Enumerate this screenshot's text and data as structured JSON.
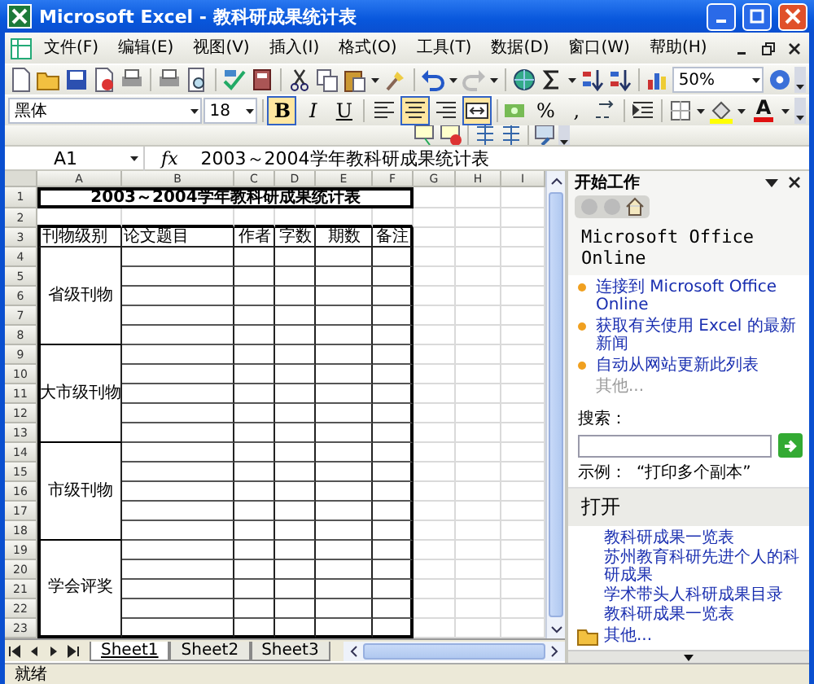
{
  "window": {
    "title": "Microsoft Excel - 教科研成果统计表"
  },
  "menu": [
    "文件(F)",
    "编辑(E)",
    "视图(V)",
    "插入(I)",
    "格式(O)",
    "工具(T)",
    "数据(D)",
    "窗口(W)",
    "帮助(H)"
  ],
  "standard_toolbar": {
    "zoom": "50%"
  },
  "format_toolbar": {
    "font": "黑体",
    "size": "18",
    "style_buttons": [
      {
        "label": "B",
        "selected": true
      },
      {
        "label": "I",
        "selected": false
      },
      {
        "label": "U",
        "selected": false
      }
    ],
    "align_buttons": [
      {
        "selected": false
      },
      {
        "selected": true
      },
      {
        "selected": false
      },
      {
        "selected": true
      }
    ],
    "percent": "%",
    "comma": ",",
    "font_color": "A"
  },
  "formula_bar": {
    "cell": "A1",
    "function_label": "fx",
    "value": "2003～2004学年教科研成果统计表"
  },
  "sheet": {
    "columns": [
      "A",
      "B",
      "C",
      "D",
      "E",
      "F",
      "G",
      "H",
      "I"
    ],
    "rows": [
      "1",
      "2",
      "3",
      "4",
      "5",
      "6",
      "7",
      "8",
      "9",
      "10",
      "11",
      "12",
      "13",
      "14",
      "15",
      "16",
      "17",
      "18",
      "19",
      "20",
      "21",
      "22",
      "23"
    ],
    "title": {
      "text": "2003～2004学年教科研成果统计表",
      "selected": true
    },
    "headers": [
      "刊物级别",
      "论文题目",
      "作者",
      "字数",
      "期数",
      "备注"
    ],
    "groups": [
      "省级刊物",
      "大市级刊物",
      "市级刊物",
      "学会评奖"
    ]
  },
  "sheet_tabs": [
    {
      "label": "Sheet1",
      "selected": true
    },
    {
      "label": "Sheet2",
      "selected": false
    },
    {
      "label": "Sheet3",
      "selected": false
    }
  ],
  "task_pane": {
    "title": "开始工作",
    "heading": "Microsoft Office Online",
    "links": [
      "连接到 Microsoft Office Online",
      "获取有关使用 Excel 的最新新闻",
      "自动从网站更新此列表"
    ],
    "more": "其他...",
    "search_label": "搜索：",
    "example_label": "示例：",
    "example": "“打印多个副本”",
    "open_heading": "打开",
    "open_files": [
      "教科研成果一览表",
      "苏州教育科研先进个人的科研成果",
      "学术带头人科研成果目录",
      "教科研成果一览表"
    ],
    "open_more": "其他..."
  },
  "status_bar": "就绪"
}
